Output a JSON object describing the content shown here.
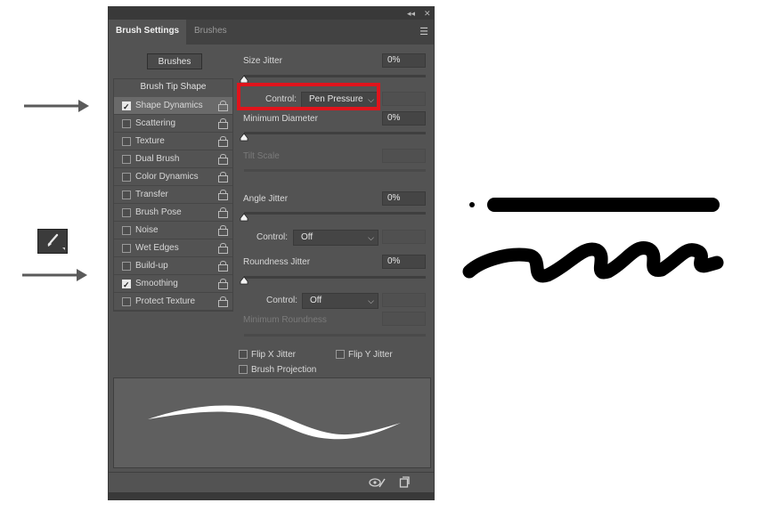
{
  "window": {
    "collapse_glyph": "◂◂",
    "close_glyph": "✕",
    "menu_glyph": "☰"
  },
  "tabs": [
    {
      "label": "Brush Settings",
      "active": true
    },
    {
      "label": "Brushes",
      "active": false
    }
  ],
  "brushes_button": "Brushes",
  "brush_tip_shape": "Brush Tip Shape",
  "options": [
    {
      "label": "Shape Dynamics",
      "checked": true,
      "selected": true
    },
    {
      "label": "Scattering",
      "checked": false
    },
    {
      "label": "Texture",
      "checked": false
    },
    {
      "label": "Dual Brush",
      "checked": false
    },
    {
      "label": "Color Dynamics",
      "checked": false
    },
    {
      "label": "Transfer",
      "checked": false
    },
    {
      "label": "Brush Pose",
      "checked": false
    },
    {
      "label": "Noise",
      "checked": false
    },
    {
      "label": "Wet Edges",
      "checked": false
    },
    {
      "label": "Build-up",
      "checked": false
    },
    {
      "label": "Smoothing",
      "checked": true
    },
    {
      "label": "Protect Texture",
      "checked": false
    }
  ],
  "settings": {
    "size_jitter": {
      "label": "Size Jitter",
      "value": "0%",
      "slider_level": 0
    },
    "control1": {
      "label": "Control:",
      "value": "Pen Pressure"
    },
    "minimum_diameter": {
      "label": "Minimum Diameter",
      "value": "0%",
      "slider_level": 0
    },
    "tilt_scale": {
      "label": "Tilt Scale"
    },
    "angle_jitter": {
      "label": "Angle Jitter",
      "value": "0%",
      "slider_level": 0
    },
    "control2": {
      "label": "Control:",
      "value": "Off"
    },
    "roundness_jitter": {
      "label": "Roundness Jitter",
      "value": "0%",
      "slider_level": 0
    },
    "control3": {
      "label": "Control:",
      "value": "Off"
    },
    "minimum_roundness": {
      "label": "Minimum Roundness"
    },
    "flip_x": {
      "label": "Flip X Jitter",
      "checked": false
    },
    "flip_y": {
      "label": "Flip Y Jitter",
      "checked": false
    },
    "brush_projection": {
      "label": "Brush Projection",
      "checked": false
    }
  },
  "highlight_color": "#e0141c",
  "bottom_icons": [
    "eye-brush-icon",
    "new-brush-icon"
  ]
}
